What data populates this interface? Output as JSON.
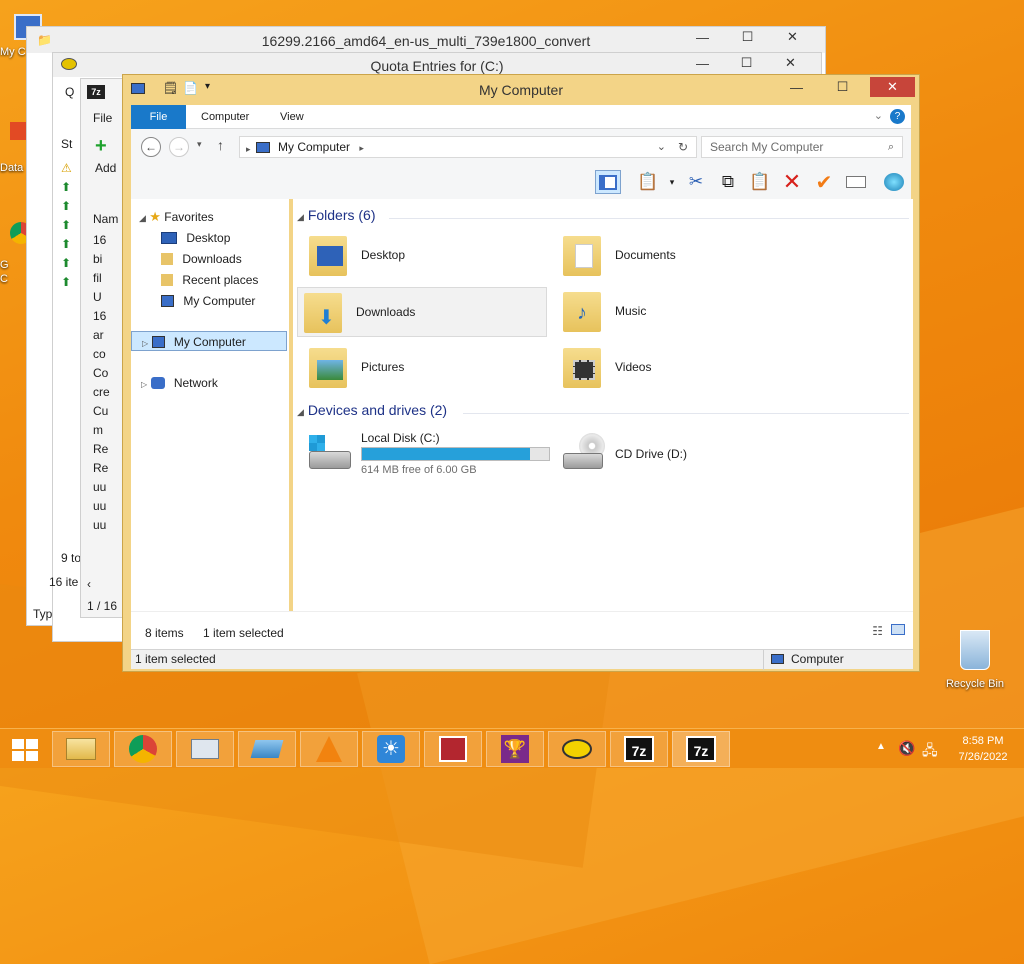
{
  "desktop": {
    "recycle_bin_label": "Recycle Bin",
    "partial_icons": [
      "My C",
      "Data",
      "G",
      "C"
    ]
  },
  "back_windows": {
    "iso_title": "16299.2166_amd64_en-us_multi_739e1800_convert",
    "quota_title": "Quota Entries for  (C:)",
    "left_fragments": {
      "tab_fragment": "Q",
      "file_label": "File",
      "add_label": "Add",
      "status_header": "St",
      "name_header": "Nam",
      "list_rows": [
        "16",
        "bi",
        "fil",
        "U",
        "16",
        "ar",
        "co",
        "Co",
        "cre",
        "Cu",
        "m",
        "Re",
        "Re",
        "uu",
        "uu",
        "uu"
      ],
      "count_a": "9 to",
      "count_b": "16 ite",
      "count_c": "1 / 16",
      "type_label": "Type: iso Archive"
    }
  },
  "main_window": {
    "title": "My Computer",
    "ribbon_tabs": [
      "File",
      "Computer",
      "View"
    ],
    "address": {
      "location": "My Computer",
      "search_placeholder": "Search My Computer"
    },
    "nav_pane": {
      "favorites_label": "Favorites",
      "favorites": [
        "Desktop",
        "Downloads",
        "Recent places",
        "My Computer"
      ],
      "selected_item": "My Computer",
      "network_label": "Network"
    },
    "folders_group": {
      "header": "Folders (6)",
      "items": [
        "Desktop",
        "Documents",
        "Downloads",
        "Music",
        "Pictures",
        "Videos"
      ]
    },
    "devices_group": {
      "header": "Devices and drives (2)",
      "local_disk": {
        "name": "Local Disk (C:)",
        "free_text": "614 MB free of 6.00 GB",
        "used_fraction": 0.9
      },
      "cd_drive": {
        "name": "CD Drive (D:)"
      }
    },
    "status": {
      "items_count": "8 items",
      "selected_count": "1 item selected",
      "bottom_left": "1 item selected",
      "bottom_right": "Computer"
    }
  },
  "taskbar": {
    "clock_time": "8:58 PM",
    "clock_date": "7/26/2022",
    "pinned": [
      "file-explorer",
      "chrome",
      "system-monitor",
      "drive",
      "vlc",
      "brightness",
      "news",
      "trophy",
      "pacman",
      "7zip",
      "7zip"
    ]
  },
  "colors": {
    "desktop": "#f08a0e",
    "window_frame": "#f3d487",
    "file_tab": "#1979ca",
    "selection": "#cce8ff",
    "close_button": "#c7453a",
    "disk_bar": "#26a0da"
  }
}
